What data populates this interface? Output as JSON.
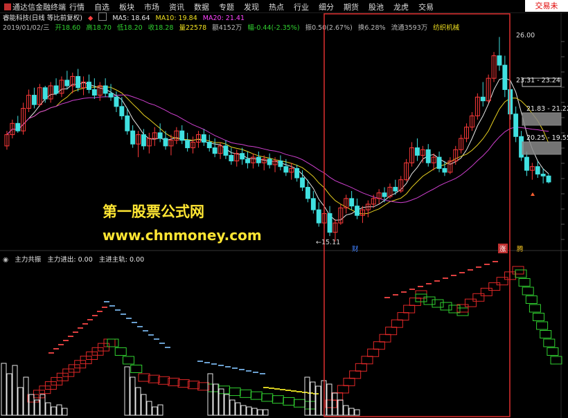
{
  "app": {
    "title": "通达信金融终端"
  },
  "menu": [
    "行情",
    "自选",
    "板块",
    "市场",
    "资讯",
    "数据",
    "专题",
    "发现",
    "热点",
    "行业",
    "细分",
    "期货",
    "股池",
    "龙虎",
    "交易"
  ],
  "trade_button": "交易未",
  "stock": {
    "name": "睿能科技(日线 等比前复权)",
    "ma5": "MA5: 18.64",
    "ma10": "MA10: 19.84",
    "ma20": "MA20: 21.41",
    "date": "2019/01/02/三",
    "open": "开18.60",
    "high": "高18.70",
    "low": "低18.20",
    "close": "收18.28",
    "volume": "量22578",
    "amount": "额4152万",
    "change": "幅-0.44(-2.35%)",
    "amplitude": "振0.50(2.67%)",
    "turnover": "换6.28%",
    "float": "流通3593万",
    "sector": "纺织机械"
  },
  "price_labels": {
    "high": "26.00",
    "low": "15.11",
    "zone1": "23.31 - 23.24",
    "zone2": "21.83 - 21.22",
    "zone3": "20.25 - 19.55"
  },
  "tags": {
    "cai": "财",
    "zhang": "涨",
    "teng": "腾"
  },
  "indicator": {
    "name": "主力共振",
    "line1": "主力进出: 0.00",
    "line2": "主进主轨: 0.00"
  },
  "watermark": {
    "line1": "第一股票公式网",
    "line2": "www.chnmoney.com"
  },
  "colors": {
    "up": "#ff3a3a",
    "down": "#40e0e0",
    "ma5": "#e8e8e8",
    "ma10": "#e8d020",
    "ma20": "#d040d0",
    "highlight": "#e03030"
  },
  "chart_data": {
    "type": "candlestick",
    "ohlc": [
      [
        20.2,
        21.0,
        20.0,
        20.8
      ],
      [
        20.8,
        21.6,
        20.6,
        21.4
      ],
      [
        21.4,
        21.8,
        20.9,
        21.0
      ],
      [
        21.0,
        22.5,
        20.8,
        22.2
      ],
      [
        22.2,
        23.2,
        22.0,
        22.9
      ],
      [
        22.9,
        23.3,
        22.2,
        22.4
      ],
      [
        22.4,
        23.5,
        22.3,
        23.3
      ],
      [
        23.3,
        23.4,
        22.5,
        22.7
      ],
      [
        22.7,
        23.6,
        22.5,
        23.4
      ],
      [
        23.4,
        23.8,
        22.9,
        23.0
      ],
      [
        23.0,
        23.9,
        22.8,
        23.7
      ],
      [
        23.7,
        24.2,
        23.2,
        23.4
      ],
      [
        23.4,
        24.1,
        23.0,
        23.9
      ],
      [
        23.9,
        24.3,
        23.1,
        23.3
      ],
      [
        23.3,
        23.9,
        22.9,
        23.6
      ],
      [
        23.6,
        24.0,
        23.0,
        23.2
      ],
      [
        23.2,
        23.8,
        22.7,
        22.9
      ],
      [
        22.9,
        23.6,
        22.6,
        23.4
      ],
      [
        23.4,
        23.8,
        22.8,
        23.0
      ],
      [
        23.0,
        23.5,
        22.6,
        22.8
      ],
      [
        22.8,
        23.1,
        22.0,
        22.3
      ],
      [
        22.3,
        22.8,
        21.6,
        21.8
      ],
      [
        21.8,
        22.2,
        20.8,
        21.0
      ],
      [
        21.0,
        21.3,
        20.1,
        20.3
      ],
      [
        20.3,
        21.0,
        19.6,
        20.8
      ],
      [
        20.8,
        21.1,
        20.0,
        20.2
      ],
      [
        20.2,
        20.9,
        19.8,
        20.6
      ],
      [
        20.6,
        21.2,
        20.2,
        20.9
      ],
      [
        20.9,
        21.4,
        20.4,
        20.6
      ],
      [
        20.6,
        21.0,
        20.0,
        20.2
      ],
      [
        20.2,
        20.8,
        19.7,
        20.5
      ],
      [
        20.5,
        21.2,
        20.3,
        21.0
      ],
      [
        21.0,
        21.3,
        20.3,
        20.5
      ],
      [
        20.5,
        20.9,
        19.9,
        20.1
      ],
      [
        20.1,
        20.7,
        19.8,
        20.4
      ],
      [
        20.4,
        21.0,
        20.1,
        20.8
      ],
      [
        20.8,
        21.1,
        20.2,
        20.4
      ],
      [
        20.4,
        20.8,
        19.9,
        20.1
      ],
      [
        20.1,
        20.6,
        19.6,
        19.8
      ],
      [
        19.8,
        20.4,
        19.5,
        20.2
      ],
      [
        20.2,
        20.5,
        19.5,
        19.7
      ],
      [
        19.7,
        20.1,
        19.2,
        19.4
      ],
      [
        19.4,
        20.0,
        19.1,
        19.8
      ],
      [
        19.8,
        20.1,
        19.2,
        19.5
      ],
      [
        19.5,
        19.9,
        19.0,
        19.3
      ],
      [
        19.3,
        19.8,
        19.0,
        19.6
      ],
      [
        19.6,
        19.9,
        19.1,
        19.3
      ],
      [
        19.3,
        19.7,
        18.9,
        19.5
      ],
      [
        19.5,
        19.8,
        19.0,
        19.2
      ],
      [
        19.2,
        19.6,
        18.8,
        19.4
      ],
      [
        19.4,
        19.7,
        18.9,
        19.1
      ],
      [
        19.1,
        19.5,
        18.6,
        18.8
      ],
      [
        18.8,
        19.3,
        18.4,
        19.0
      ],
      [
        19.0,
        19.2,
        18.3,
        18.5
      ],
      [
        18.5,
        18.9,
        17.8,
        18.0
      ],
      [
        18.0,
        18.4,
        17.2,
        17.4
      ],
      [
        17.4,
        17.8,
        16.6,
        16.8
      ],
      [
        16.8,
        17.2,
        15.9,
        16.1
      ],
      [
        16.1,
        16.8,
        15.8,
        16.6
      ],
      [
        16.6,
        17.0,
        15.4,
        15.6
      ],
      [
        15.6,
        16.3,
        15.11,
        16.1
      ],
      [
        16.1,
        17.1,
        16.0,
        16.9
      ],
      [
        16.9,
        17.6,
        16.6,
        17.4
      ],
      [
        17.4,
        17.8,
        16.8,
        17.0
      ],
      [
        17.0,
        17.4,
        16.3,
        16.5
      ],
      [
        16.5,
        17.0,
        16.1,
        16.8
      ],
      [
        16.8,
        17.3,
        16.4,
        17.1
      ],
      [
        17.1,
        17.6,
        16.9,
        17.4
      ],
      [
        17.4,
        17.9,
        17.1,
        17.7
      ],
      [
        17.7,
        18.0,
        17.2,
        17.5
      ],
      [
        17.5,
        18.2,
        17.4,
        18.0
      ],
      [
        18.0,
        18.4,
        17.6,
        17.8
      ],
      [
        17.8,
        18.6,
        17.7,
        18.4
      ],
      [
        18.4,
        19.5,
        18.3,
        19.3
      ],
      [
        19.3,
        20.4,
        19.1,
        20.1
      ],
      [
        20.1,
        20.6,
        19.4,
        19.7
      ],
      [
        19.7,
        20.2,
        19.3,
        20.0
      ],
      [
        20.0,
        20.3,
        19.1,
        19.3
      ],
      [
        19.3,
        19.8,
        18.9,
        19.6
      ],
      [
        19.6,
        19.9,
        18.8,
        19.0
      ],
      [
        19.0,
        19.4,
        18.6,
        18.8
      ],
      [
        18.8,
        19.6,
        18.7,
        19.4
      ],
      [
        19.4,
        20.2,
        19.2,
        20.0
      ],
      [
        20.0,
        20.8,
        19.8,
        20.6
      ],
      [
        20.6,
        21.4,
        20.4,
        21.2
      ],
      [
        21.2,
        22.0,
        21.0,
        21.8
      ],
      [
        21.8,
        23.0,
        21.6,
        22.8
      ],
      [
        22.8,
        23.6,
        22.3,
        22.6
      ],
      [
        22.6,
        24.0,
        22.5,
        23.8
      ],
      [
        23.8,
        25.2,
        23.6,
        25.0
      ],
      [
        25.0,
        26.0,
        24.2,
        24.5
      ],
      [
        24.5,
        25.0,
        22.8,
        23.2
      ],
      [
        23.2,
        23.6,
        21.6,
        21.9
      ],
      [
        21.9,
        22.3,
        20.4,
        20.7
      ],
      [
        20.7,
        21.0,
        19.4,
        19.6
      ],
      [
        19.6,
        19.9,
        18.6,
        18.9
      ],
      [
        18.9,
        19.3,
        18.4,
        19.1
      ],
      [
        19.1,
        19.4,
        18.5,
        18.7
      ],
      [
        18.7,
        19.0,
        18.2,
        18.6
      ],
      [
        18.6,
        18.7,
        18.2,
        18.28
      ]
    ]
  }
}
